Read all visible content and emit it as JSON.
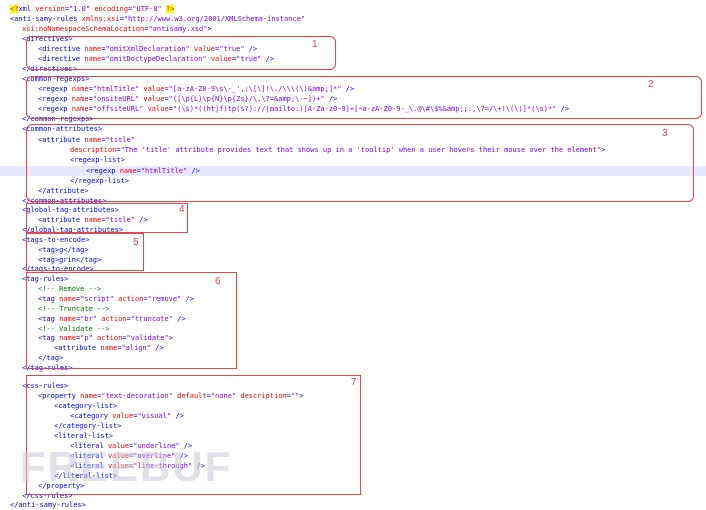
{
  "lines": {
    "l01": "<?xml version=\"1.0\" encoding=\"UTF-8\" ?>",
    "l02": "<anti-samy-rules xmlns:xsi=\"http://www.w3.org/2001/XMLSchema-instance\"",
    "l03": "xsi:noNamespaceSchemaLocation=\"antisamy.xsd\">",
    "l04": "<directives>",
    "l05": "<directive name=\"omitXmlDeclaration\" value=\"true\" />",
    "l06": "<directive name=\"omitDoctypeDeclaration\" value=\"true\" />",
    "l07": "</directives>",
    "l08": "<common-regexps>",
    "l09": "<regexp name=\"htmlTitle\" value=\"[a-zA-Z0-9\\s\\-_',:\\[\\]!\\./\\\\\\(\\)&amp;]*\" />",
    "l10": "<regexp name=\"onsiteURL\" value=\"([\\p{L}\\p{N}\\p{Zs}/\\.\\?=&amp;\\-~])+\" />",
    "l11": "<regexp name=\"offsiteURL\" value=\"(\\s)*((ht|f)tp(s?)://|mailto:)[A-Za-z0-9]+[~a-zA-Z0-9-_\\.@\\#\\$%&amp;;:,\\?=/\\+!\\(\\)]*(\\s)*\" />",
    "l12": "</common-regexps>",
    "l13": "<common-attributes>",
    "l14": "<attribute name=\"title\"",
    "l15": "description=\"The 'title' attribute provides text that shows up in a 'tooltip' when a user hovers their mouse over the element\">",
    "l16": "<regexp-list>",
    "l17": "<regexp name=\"htmlTitle\" />",
    "l18": "</regexp-list>",
    "l19": "</attribute>",
    "l20": "</common-attributes>",
    "l21": "<global-tag-attributes>",
    "l22": "<attribute name=\"title\" />",
    "l23": "</global-tag-attributes>",
    "l24": "<tags-to-encode>",
    "l25": "<tag>g</tag>",
    "l26": "<tag>grin</tag>",
    "l27": "</tags-to-encode>",
    "l28": "<tag-rules>",
    "l29": "<!-- Remove -->",
    "l30": "<tag name=\"script\" action=\"remove\" />",
    "l31": "<!-- Truncate -->",
    "l32": "<tag name=\"br\" action=\"truncate\" />",
    "l33": "<!-- Validate -->",
    "l34": "<tag name=\"p\" action=\"validate\">",
    "l35": "<attribute name=\"align\" />",
    "l36": "</tag>",
    "l37": "</tag-rules>",
    "l38": "<css-rules>",
    "l39": "<property name=\"text-decoration\" default=\"none\" description=\"\">",
    "l40": "<category-list>",
    "l41": "<category value=\"visual\" />",
    "l42": "</category-list>",
    "l43": "<literal-list>",
    "l44": "<literal value=\"underline\" />",
    "l45": "<literal value=\"overline\" />",
    "l46": "<literal value=\"line-through\" />",
    "l47": "</literal-list>",
    "l48": "</property>",
    "l49": "</css-rules>",
    "l50": "</anti-samy-rules>"
  },
  "annotations": [
    "1",
    "2",
    "3",
    "4",
    "5",
    "6",
    "7"
  ],
  "watermark": "FREEBUF",
  "colors": {
    "tag": "#0000ff",
    "attribute": "#ff0000",
    "value": "#8000ff",
    "comment": "#008000",
    "annotation_box": "#e0484b"
  }
}
